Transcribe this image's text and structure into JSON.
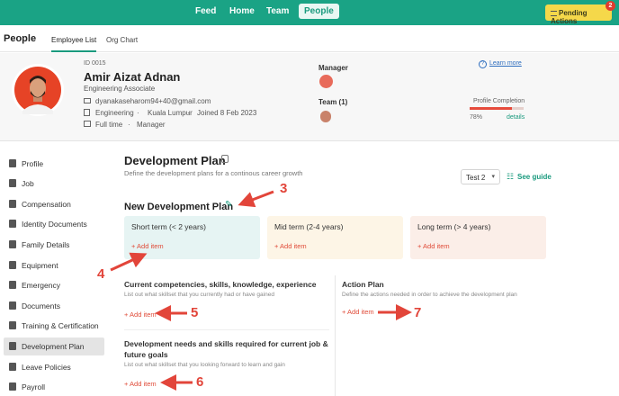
{
  "nav": {
    "items": [
      "Feed",
      "Home",
      "Team",
      "People"
    ],
    "pending_label": "Pending Actions",
    "pending_count": "2"
  },
  "subnav": {
    "title": "People",
    "tabs": [
      "Employee List",
      "Org Chart"
    ]
  },
  "profile": {
    "id": "ID 0015",
    "name": "Amir Aizat Adnan",
    "role": "Engineering Associate",
    "email": "dyanakaseharom94+40@gmail.com",
    "department": "Engineering",
    "location": "Kuala Lumpur",
    "joined": "Joined 8 Feb 2023",
    "employment_type": "Full time",
    "position": "Manager",
    "manager_label": "Manager",
    "team_label": "Team (1)",
    "learn_more": "Learn more",
    "completion_label": "Profile Completion",
    "completion_value": "78%",
    "completion_fraction": 0.78,
    "details_link": "details"
  },
  "sidebar": {
    "items": [
      "Profile",
      "Job",
      "Compensation",
      "Identity Documents",
      "Family Details",
      "Equipment",
      "Emergency",
      "Documents",
      "Training & Certification",
      "Development Plan",
      "Leave Policies",
      "Payroll"
    ],
    "active": "Development Plan"
  },
  "main": {
    "title": "Development Plan",
    "subtitle": "Define the development plans for a continous career growth",
    "select_value": "Test 2",
    "see_guide": "See guide",
    "new_plan_title": "New Development Plan",
    "terms": [
      {
        "label": "Short term (< 2 years)",
        "add": "+ Add item"
      },
      {
        "label": "Mid term (2-4 years)",
        "add": "+ Add item"
      },
      {
        "label": "Long term (> 4 years)",
        "add": "+ Add item"
      }
    ],
    "competencies": {
      "title": "Current competencies, skills, knowledge, experience",
      "desc": "List out what skillset that you currently had or have gained",
      "add": "+ Add item"
    },
    "action_plan": {
      "title": "Action Plan",
      "desc": "Define the actions needed in order to achieve the development plan",
      "add": "+ Add item"
    },
    "needs": {
      "title_line1": "Development needs and skills required for current job &",
      "title_line2": "future goals",
      "desc": "List out what skillset that you looking forward to learn and gain",
      "add": "+ Add item"
    }
  },
  "annotations": [
    "3",
    "4",
    "5",
    "6",
    "7"
  ],
  "colors": {
    "brand": "#1aa385",
    "accent_red": "#e2453a",
    "short_term_bg": "#e6f4f3",
    "mid_term_bg": "#fdf5e6",
    "long_term_bg": "#fbeee8"
  }
}
